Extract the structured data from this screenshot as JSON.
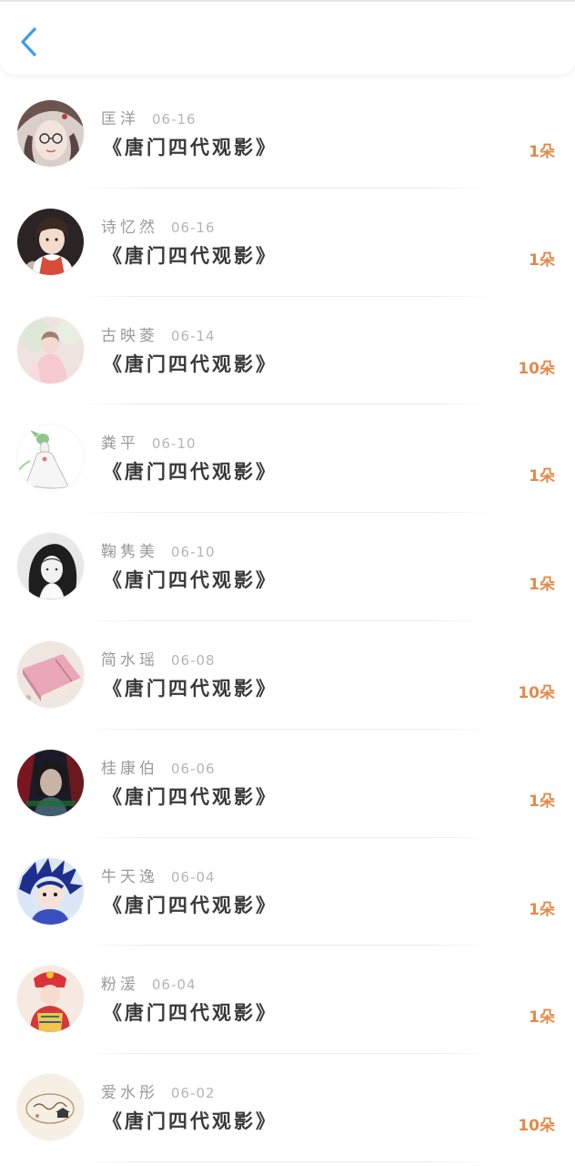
{
  "header": {
    "back_icon": "chevron-left-icon",
    "title": "",
    "accent_color": "#3a9ee8"
  },
  "colors": {
    "amount": "#e28a4a",
    "name": "#9a9a9a",
    "book": "#3a3a3a"
  },
  "list": {
    "items": [
      {
        "name": "匡洋",
        "date": "06-16",
        "book": "《唐门四代观影》",
        "amount": "1朵",
        "avatar": "avatar-girl-glasses"
      },
      {
        "name": "诗忆然",
        "date": "06-16",
        "book": "《唐门四代观影》",
        "amount": "1朵",
        "avatar": "avatar-anime-boy"
      },
      {
        "name": "古映菱",
        "date": "06-14",
        "book": "《唐门四代观影》",
        "amount": "10朵",
        "avatar": "avatar-pink-photo"
      },
      {
        "name": "粪平",
        "date": "06-10",
        "book": "《唐门四代观影》",
        "amount": "1朵",
        "avatar": "avatar-white-figure"
      },
      {
        "name": "鞠隽美",
        "date": "06-10",
        "book": "《唐门四代观影》",
        "amount": "1朵",
        "avatar": "avatar-sketch-girl"
      },
      {
        "name": "简水瑶",
        "date": "06-08",
        "book": "《唐门四代观影》",
        "amount": "10朵",
        "avatar": "avatar-pink-notebook"
      },
      {
        "name": "桂康伯",
        "date": "06-06",
        "book": "《唐门四代观影》",
        "amount": "1朵",
        "avatar": "avatar-dark-portrait"
      },
      {
        "name": "牛天逸",
        "date": "06-04",
        "book": "《唐门四代观影》",
        "amount": "1朵",
        "avatar": "avatar-blue-anime"
      },
      {
        "name": "粉湲",
        "date": "06-04",
        "book": "《唐门四代观影》",
        "amount": "1朵",
        "avatar": "avatar-red-costume"
      },
      {
        "name": "爱水彤",
        "date": "06-02",
        "book": "《唐门四代观影》",
        "amount": "10朵",
        "avatar": "avatar-doodle-cream"
      }
    ]
  }
}
